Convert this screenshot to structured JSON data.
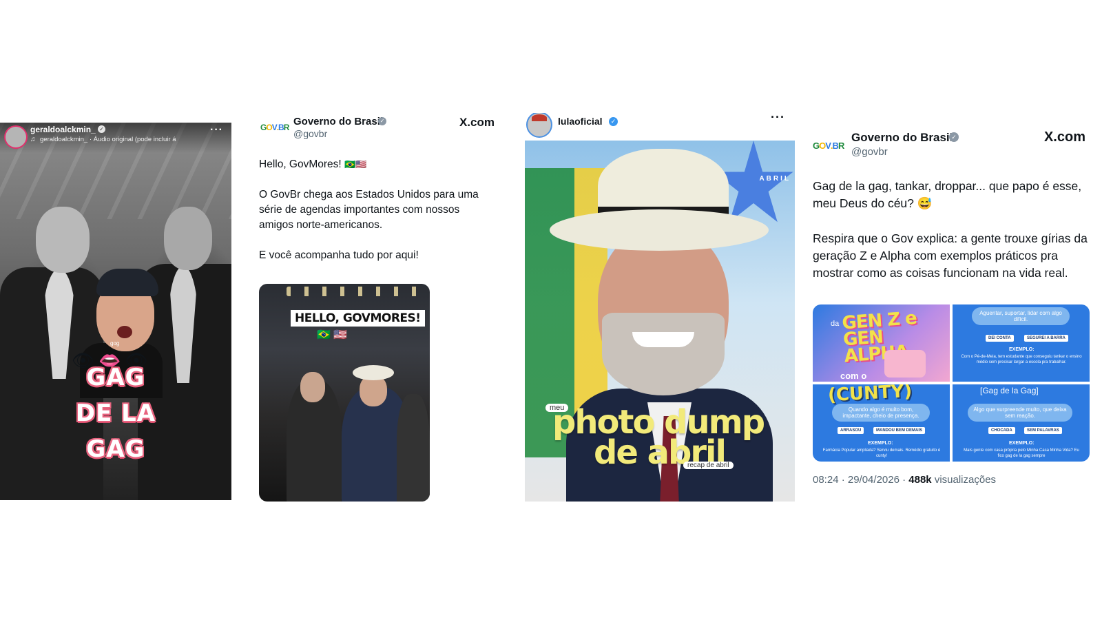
{
  "panel1": {
    "username": "geraldoalckmin_",
    "audio": "geraldoalckmin_ · Áudio original (pode incluir á",
    "sticker_lines": [
      "GAG",
      "DE LA",
      "GAG"
    ],
    "sticker_tag": "gog"
  },
  "panel2": {
    "account_name": "Governo do Brasil",
    "handle": "@govbr",
    "site": "X.com",
    "logo_text": "GOV.BR",
    "greeting": "Hello, GovMores!",
    "greeting_flags": "🇧🇷🇺🇸",
    "paragraph": "O GovBr chega aos Estados Unidos para uma série de agendas importantes com nossos amigos norte-americanos.",
    "closing": "E você acompanha tudo por aqui!",
    "media_banner": "HELLO, GOVMORES!",
    "media_flags": "🇧🇷 🇺🇸"
  },
  "panel3": {
    "username": "lulaoficial",
    "badge_text": "ABRIL",
    "tag_meu": "meu",
    "title_line1": "photo dump",
    "title_line2": "de abril",
    "tag_recap": "recap de abril"
  },
  "panel4": {
    "account_name": "Governo do Brasil",
    "handle": "@govbr",
    "site": "X.com",
    "logo_text": "GOV.BR",
    "paragraph1": "Gag de la gag, tankar, droppar... que papo é esse, meu Deus do céu? 😅",
    "paragraph2": "Respira que o Gov explica: a gente trouxe gírias da geração Z e Alpha com exemplos práticos pra mostrar como as coisas funcionam na vida real.",
    "cards": {
      "c1_da": "da",
      "c1_title": "GEN Z e GEN ALPHA",
      "c1_como": "com o",
      "c2_bubble": "Aguentar, suportar, lidar com algo difícil.",
      "c2_chips": [
        "DEI CONTA",
        "SEGUREI A BARRA"
      ],
      "c2_example_label": "EXEMPLO:",
      "c2_example": "Com o Pé-de-Meia, tem estudante que conseguiu tankar o ensino médio sem precisar largar a escola pra trabalhar.",
      "c3_title": "(CUNTY)",
      "c3_bubble": "Quando algo é muito bom, impactante, cheio de presença.",
      "c3_chips": [
        "ARRASOU",
        "MANDOU BEM DEMAIS"
      ],
      "c3_example_label": "EXEMPLO:",
      "c3_example": "Farmácia Popular ampliada? Serviu demais. Remédio gratuito é cunty!",
      "c4_title": "[Gag de la Gag]",
      "c4_bubble": "Algo que surpreende muito, que deixa sem reação.",
      "c4_chips": [
        "CHOCADA",
        "SEM PALAVRAS"
      ],
      "c4_example_label": "EXEMPLO:",
      "c4_example": "Mais gente com casa própria pelo Minha Casa Minha Vida? Eu fico gag de la gag sempre"
    },
    "time": "08:24 · 29/04/2026 ·",
    "views_count": "488k",
    "views_label": "visualizações"
  },
  "colors": {
    "gag_pink": "#e8637f",
    "photo_dump_yellow": "#f2ea7a",
    "govbr_blue": "#2d7ae0",
    "x_gray": "#536471"
  }
}
